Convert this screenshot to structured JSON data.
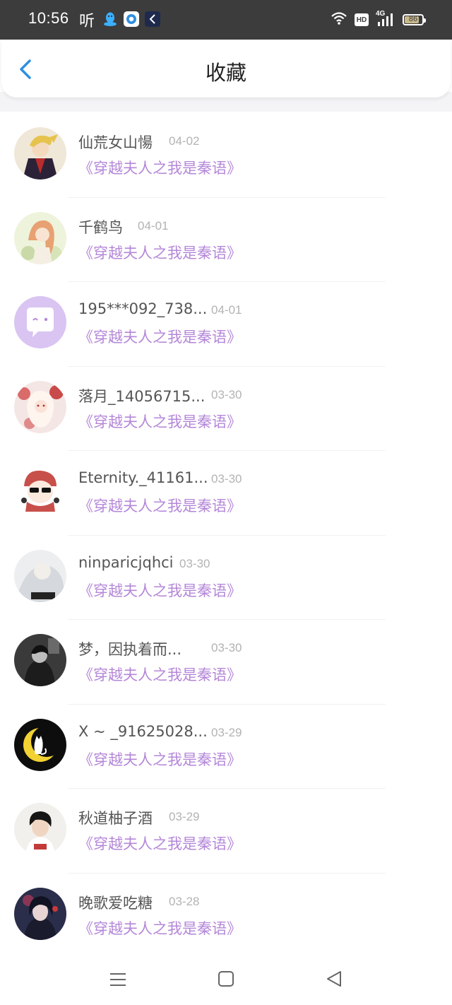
{
  "status_bar": {
    "time": "10:56",
    "ting": "听",
    "icons": [
      "qq-icon",
      "browser-icon",
      "app-icon",
      "wifi-icon",
      "hd-icon",
      "signal-4g-icon",
      "battery-icon"
    ],
    "hd": "HD",
    "network": "4G",
    "battery": "86",
    "battery_level": 0.86
  },
  "header": {
    "title": "收藏",
    "back_icon": "chevron-left-icon"
  },
  "colors": {
    "accent": "#2f8fe0",
    "book_title": "#b487d8",
    "name": "#555555",
    "date": "#b3b3b3",
    "status_bar": "#3c3c3c"
  },
  "favorites": [
    {
      "name": "仙荒女山愓",
      "date": "04-02",
      "book": "《穿越夫人之我是秦语》"
    },
    {
      "name": "千鹤鸟",
      "date": "04-01",
      "book": "《穿越夫人之我是秦语》"
    },
    {
      "name": "195***092_738...",
      "date": "04-01",
      "book": "《穿越夫人之我是秦语》"
    },
    {
      "name": "落月_14056715...",
      "date": "03-30",
      "book": "《穿越夫人之我是秦语》"
    },
    {
      "name": "Eternity._41161...",
      "date": "03-30",
      "book": "《穿越夫人之我是秦语》"
    },
    {
      "name": "ninparicjqhci",
      "date": "03-30",
      "book": "《穿越夫人之我是秦语》"
    },
    {
      "name": "梦，因执着而...",
      "date": "03-30",
      "book": "《穿越夫人之我是秦语》"
    },
    {
      "name": "X ~ _91625028...",
      "date": "03-29",
      "book": "《穿越夫人之我是秦语》"
    },
    {
      "name": "秋道柚子酒",
      "date": "03-29",
      "book": "《穿越夫人之我是秦语》"
    },
    {
      "name": "晚歌爱吃糖",
      "date": "03-28",
      "book": "《穿越夫人之我是秦语》"
    }
  ],
  "nav_bar": {
    "icons": [
      "menu-icon",
      "home-icon",
      "back-triangle-icon"
    ]
  }
}
